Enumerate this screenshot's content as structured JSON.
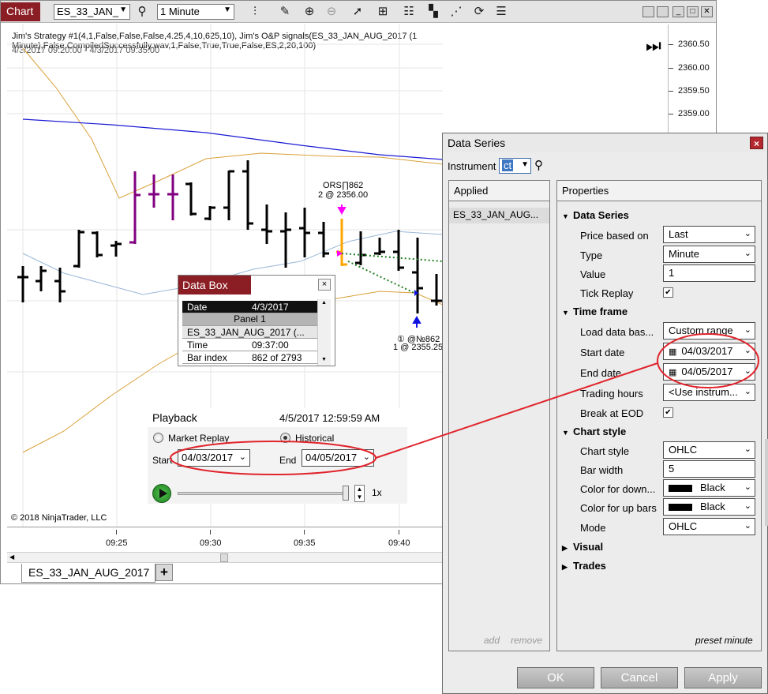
{
  "toolbar": {
    "chart_tab": "Chart",
    "instrument": "ES_33_JAN_",
    "interval": "1 Minute"
  },
  "chart": {
    "strategy_line1": "Jim's Strategy #1(4,1,False,False,False,4.25,4,10,625,10), Jim's O&P signals(ES_33_JAN_AUG_2017 (1",
    "strategy_line2": "Minute),False,CompiledSuccessfully.wav,1,False,True,True,False,ES,2,20,100)",
    "date_range": "4/3/2017 09:20:00 - 4/3/2017 09:35:00",
    "prices": [
      "2360.50",
      "2360.00",
      "2359.50",
      "2359.00"
    ],
    "times": [
      "09:25",
      "09:30",
      "09:35",
      "09:40"
    ],
    "ors_label": "ORS∏862",
    "ors_fill": "2 @ 2356.00",
    "long_label": "① @№862",
    "long_fill": "1 @ 2355.25",
    "copyright": "© 2018 NinjaTrader, LLC",
    "bottom_tab": "ES_33_JAN_AUG_2017",
    "add_tab": "+",
    "colors": {
      "bar": "#000000",
      "up_highlight": "#800080",
      "signal": "#ffa500",
      "avg_upper": "#d9a13a",
      "avg_long": "#1a1ad4",
      "avg_mid": "#9ab8d8",
      "accent": "#8b1e24"
    }
  },
  "data_box": {
    "title": "Data Box",
    "close": "×",
    "rows": [
      {
        "label": "Date",
        "value": "4/3/2017"
      },
      {
        "label": "Panel 1",
        "value": ""
      },
      {
        "label": "ES_33_JAN_AUG_2017 (...",
        "value": ""
      },
      {
        "label": "Time",
        "value": "09:37:00"
      },
      {
        "label": "Bar index",
        "value": "862 of 2793"
      }
    ]
  },
  "playback": {
    "title": "Playback",
    "timestamp": "4/5/2017 12:59:59 AM",
    "market_replay": "Market Replay",
    "historical": "Historical",
    "start_label": "Start",
    "start_value": "04/03/2017",
    "end_label": "End",
    "end_value": "04/05/2017",
    "speed": "1x"
  },
  "data_series": {
    "title": "Data Series",
    "close": "×",
    "instrument_label": "Instrument",
    "instrument_value": "ct",
    "applied_header": "Applied",
    "applied_item": "ES_33_JAN_AUG...",
    "add": "add",
    "remove": "remove",
    "properties_header": "Properties",
    "preset": "preset minute",
    "sections": {
      "data_series": "Data Series",
      "time_frame": "Time frame",
      "chart_style": "Chart style",
      "visual": "Visual",
      "trades": "Trades"
    },
    "props": {
      "price_based_on": {
        "label": "Price based on",
        "value": "Last"
      },
      "type": {
        "label": "Type",
        "value": "Minute"
      },
      "value": {
        "label": "Value",
        "value": "1"
      },
      "tick_replay": {
        "label": "Tick Replay",
        "checked": "✔"
      },
      "load_data": {
        "label": "Load data bas...",
        "value": "Custom range"
      },
      "start_date": {
        "label": "Start date",
        "value": "04/03/2017"
      },
      "end_date": {
        "label": "End date",
        "value": "04/05/2017"
      },
      "trading_hours": {
        "label": "Trading hours",
        "value": "<Use instrum..."
      },
      "break_eod": {
        "label": "Break at EOD",
        "checked": "✔"
      },
      "chart_style": {
        "label": "Chart style",
        "value": "OHLC"
      },
      "bar_width": {
        "label": "Bar width",
        "value": "5"
      },
      "color_down": {
        "label": "Color for down...",
        "value": "Black"
      },
      "color_up": {
        "label": "Color for up bars",
        "value": "Black"
      },
      "mode": {
        "label": "Mode",
        "value": "OHLC"
      }
    },
    "buttons": {
      "ok": "OK",
      "cancel": "Cancel",
      "apply": "Apply"
    }
  }
}
